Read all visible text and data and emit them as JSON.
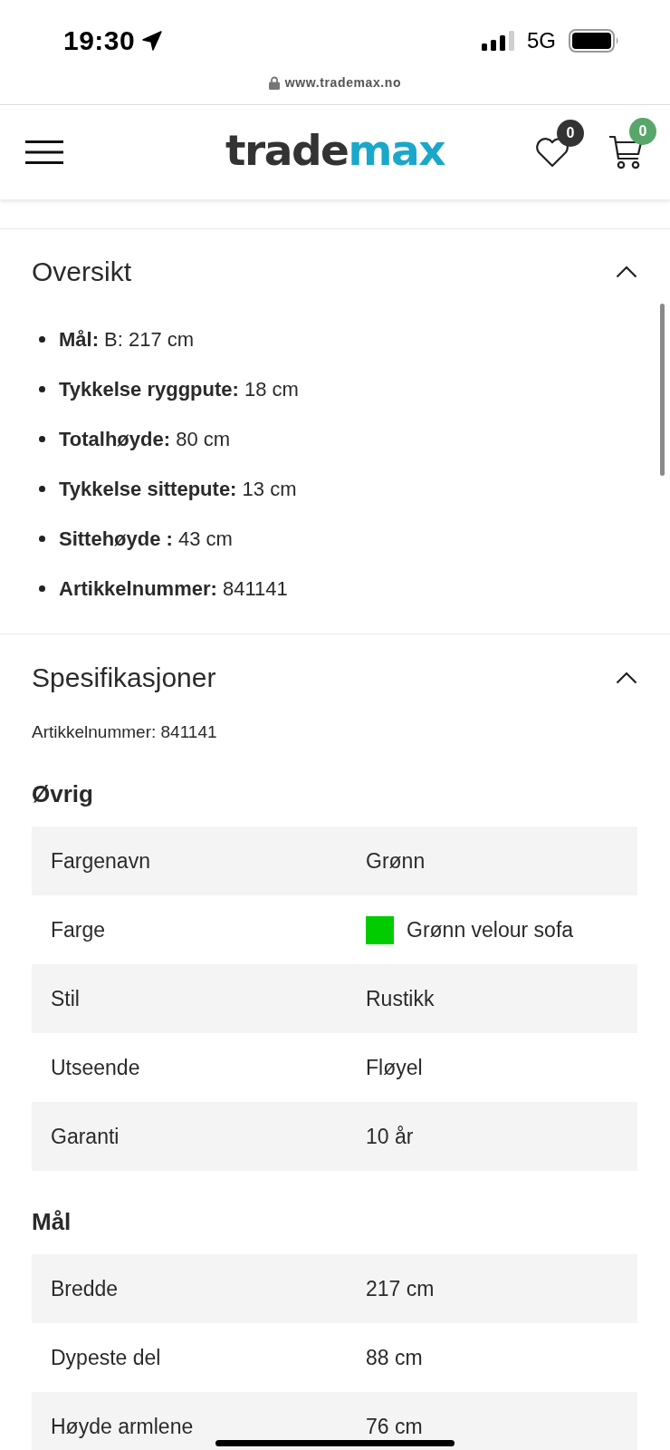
{
  "status_bar": {
    "time": "19:30",
    "network": "5G"
  },
  "address_bar": {
    "url": "www.trademax.no"
  },
  "header": {
    "logo": [
      {
        "text": "trade",
        "color": "#333333"
      },
      {
        "text": "max",
        "color": "#1ba7c9"
      }
    ],
    "wishlist_count": "0",
    "cart_count": "0"
  },
  "sections": [
    {
      "kind": "list",
      "title": "Oversikt",
      "expanded": true,
      "items": [
        "**Mål:** B: 217 cm",
        "**Tykkelse ryggpute:** 18 cm",
        "**Totalhøyde:** 80 cm",
        "**Tykkelse sittepute:** 13 cm",
        "**Sittehøyde :** 43 cm",
        "**Artikkelnummer:** 841141"
      ]
    },
    {
      "kind": "specs",
      "title": "Spesifikasjoner",
      "expanded": true,
      "article_number": "Artikkelnummer: 841141",
      "groups": [
        {
          "title": "Øvrig",
          "rows": [
            {
              "label": "Fargenavn",
              "value": "Grønn"
            },
            {
              "label": "Farge",
              "value": "Grønn velour sofa",
              "color": "#00cc00"
            },
            {
              "label": "Stil",
              "value": "Rustikk"
            },
            {
              "label": "Utseende",
              "value": "Fløyel"
            },
            {
              "label": "Garanti",
              "value": "10 år"
            }
          ]
        },
        {
          "title": "Mål",
          "rows": [
            {
              "label": "Bredde",
              "value": "217 cm"
            },
            {
              "label": "Dypeste del",
              "value": "88 cm"
            },
            {
              "label": "Høyde armlene",
              "value": "76 cm"
            }
          ]
        }
      ]
    }
  ]
}
